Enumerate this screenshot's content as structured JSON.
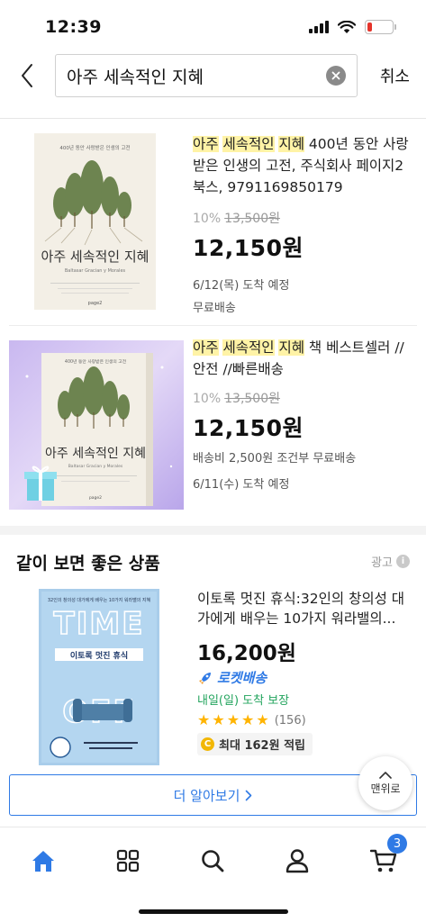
{
  "status_bar": {
    "time": "12:39",
    "battery_level": 0.2
  },
  "search": {
    "query": "아주 세속적인 지혜",
    "cancel_label": "취소"
  },
  "results": [
    {
      "title_highlight": [
        "아주",
        "세속적인",
        "지혜"
      ],
      "title_rest": "400년 동안 사랑받은 인생의 고전, 주식회사 페이지2북스, 9791169850179",
      "discount": "10%",
      "original_price": "13,500원",
      "price": "12,150원",
      "meta": [
        "6/12(목) 도착 예정",
        "무료배송"
      ],
      "cover": {
        "subtitle": "400년 동안 사랑받은 인생의 고전",
        "title": "아주 세속적인 지혜",
        "english": "Baltasar Gracian y Morales",
        "publisher": "page2"
      }
    },
    {
      "title_highlight": [
        "아주",
        "세속적인",
        "지혜"
      ],
      "title_rest": "책 베스트셀러 // 안전 //빠른배송",
      "discount": "10%",
      "original_price": "13,500원",
      "price": "12,150원",
      "meta": [
        "배송비 2,500원 조건부 무료배송",
        "6/11(수) 도착 예정"
      ],
      "cover": {
        "subtitle": "400년 동안 사랑받은 인생의 고전",
        "title": "아주 세속적인 지혜",
        "english": "Baltasar Gracian y Morales",
        "publisher": "page2"
      }
    }
  ],
  "recommendations": {
    "section_title": "같이 보면 좋은 상품",
    "ad_label": "광고",
    "item": {
      "title": "이토록 멋진 휴식:32인의 창의성 대가에게 배우는 10가지 워라밸의...",
      "price": "16,200원",
      "rocket_label": "로켓배송",
      "arrival": "내일(일) 도착 보장",
      "rating": 5,
      "review_count": "(156)",
      "cash_back": "최대 162원 적립",
      "cover": {
        "top_line": "32인의 창의성 대가에게 배우는 10가지 워라밸의 지혜",
        "word1": "TIME",
        "word2": "OFF",
        "korean_title": "이토록 멋진 휴식"
      }
    },
    "more_label": "더 알아보기",
    "top_label": "맨위로"
  },
  "tab_bar": {
    "cart_count": "3"
  },
  "colors": {
    "accent": "#2f7ae5",
    "highlight": "#fff3a6",
    "rocket": "#2f7ae5",
    "arrival": "#22a45d",
    "star": "#ffb400"
  }
}
